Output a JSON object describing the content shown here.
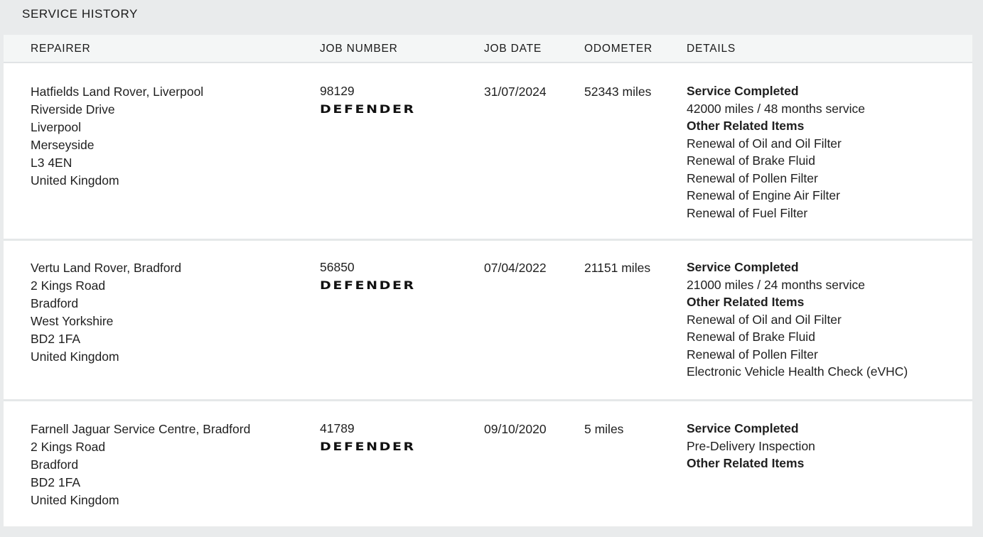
{
  "section": {
    "title": "SERVICE HISTORY"
  },
  "columns": {
    "repairer": "REPAIRER",
    "job_number": "JOB NUMBER",
    "job_date": "JOB DATE",
    "odometer": "ODOMETER",
    "details": "DETAILS"
  },
  "rows": [
    {
      "repairer": [
        "Hatfields Land Rover, Liverpool",
        "Riverside Drive",
        "Liverpool",
        "Merseyside",
        "L3 4EN",
        "United Kingdom"
      ],
      "job_number": "98129",
      "model_logo": "DEFENDER",
      "job_date": "31/07/2024",
      "odometer": "52343 miles",
      "details": {
        "heading1": "Service Completed",
        "service": "42000 miles / 48 months service",
        "heading2": "Other Related Items",
        "items": [
          "Renewal of Oil and Oil Filter",
          "Renewal of Brake Fluid",
          "Renewal of Pollen Filter",
          "Renewal of Engine Air Filter",
          "Renewal of Fuel Filter"
        ]
      }
    },
    {
      "repairer": [
        "Vertu Land Rover, Bradford",
        "2 Kings Road",
        "Bradford",
        "West Yorkshire",
        "BD2 1FA",
        "United Kingdom"
      ],
      "job_number": "56850",
      "model_logo": "DEFENDER",
      "job_date": "07/04/2022",
      "odometer": "21151 miles",
      "details": {
        "heading1": "Service Completed",
        "service": "21000 miles / 24 months service",
        "heading2": "Other Related Items",
        "items": [
          "Renewal of Oil and Oil Filter",
          "Renewal of Brake Fluid",
          "Renewal of Pollen Filter",
          "Electronic Vehicle Health Check (eVHC)"
        ]
      }
    },
    {
      "repairer": [
        "Farnell Jaguar Service Centre, Bradford",
        "2 Kings Road",
        "Bradford",
        "BD2 1FA",
        "United Kingdom"
      ],
      "job_number": "41789",
      "model_logo": "DEFENDER",
      "job_date": "09/10/2020",
      "odometer": "5 miles",
      "details": {
        "heading1": "Service Completed",
        "service": "Pre-Delivery Inspection",
        "heading2": "Other Related Items",
        "items": []
      }
    }
  ]
}
